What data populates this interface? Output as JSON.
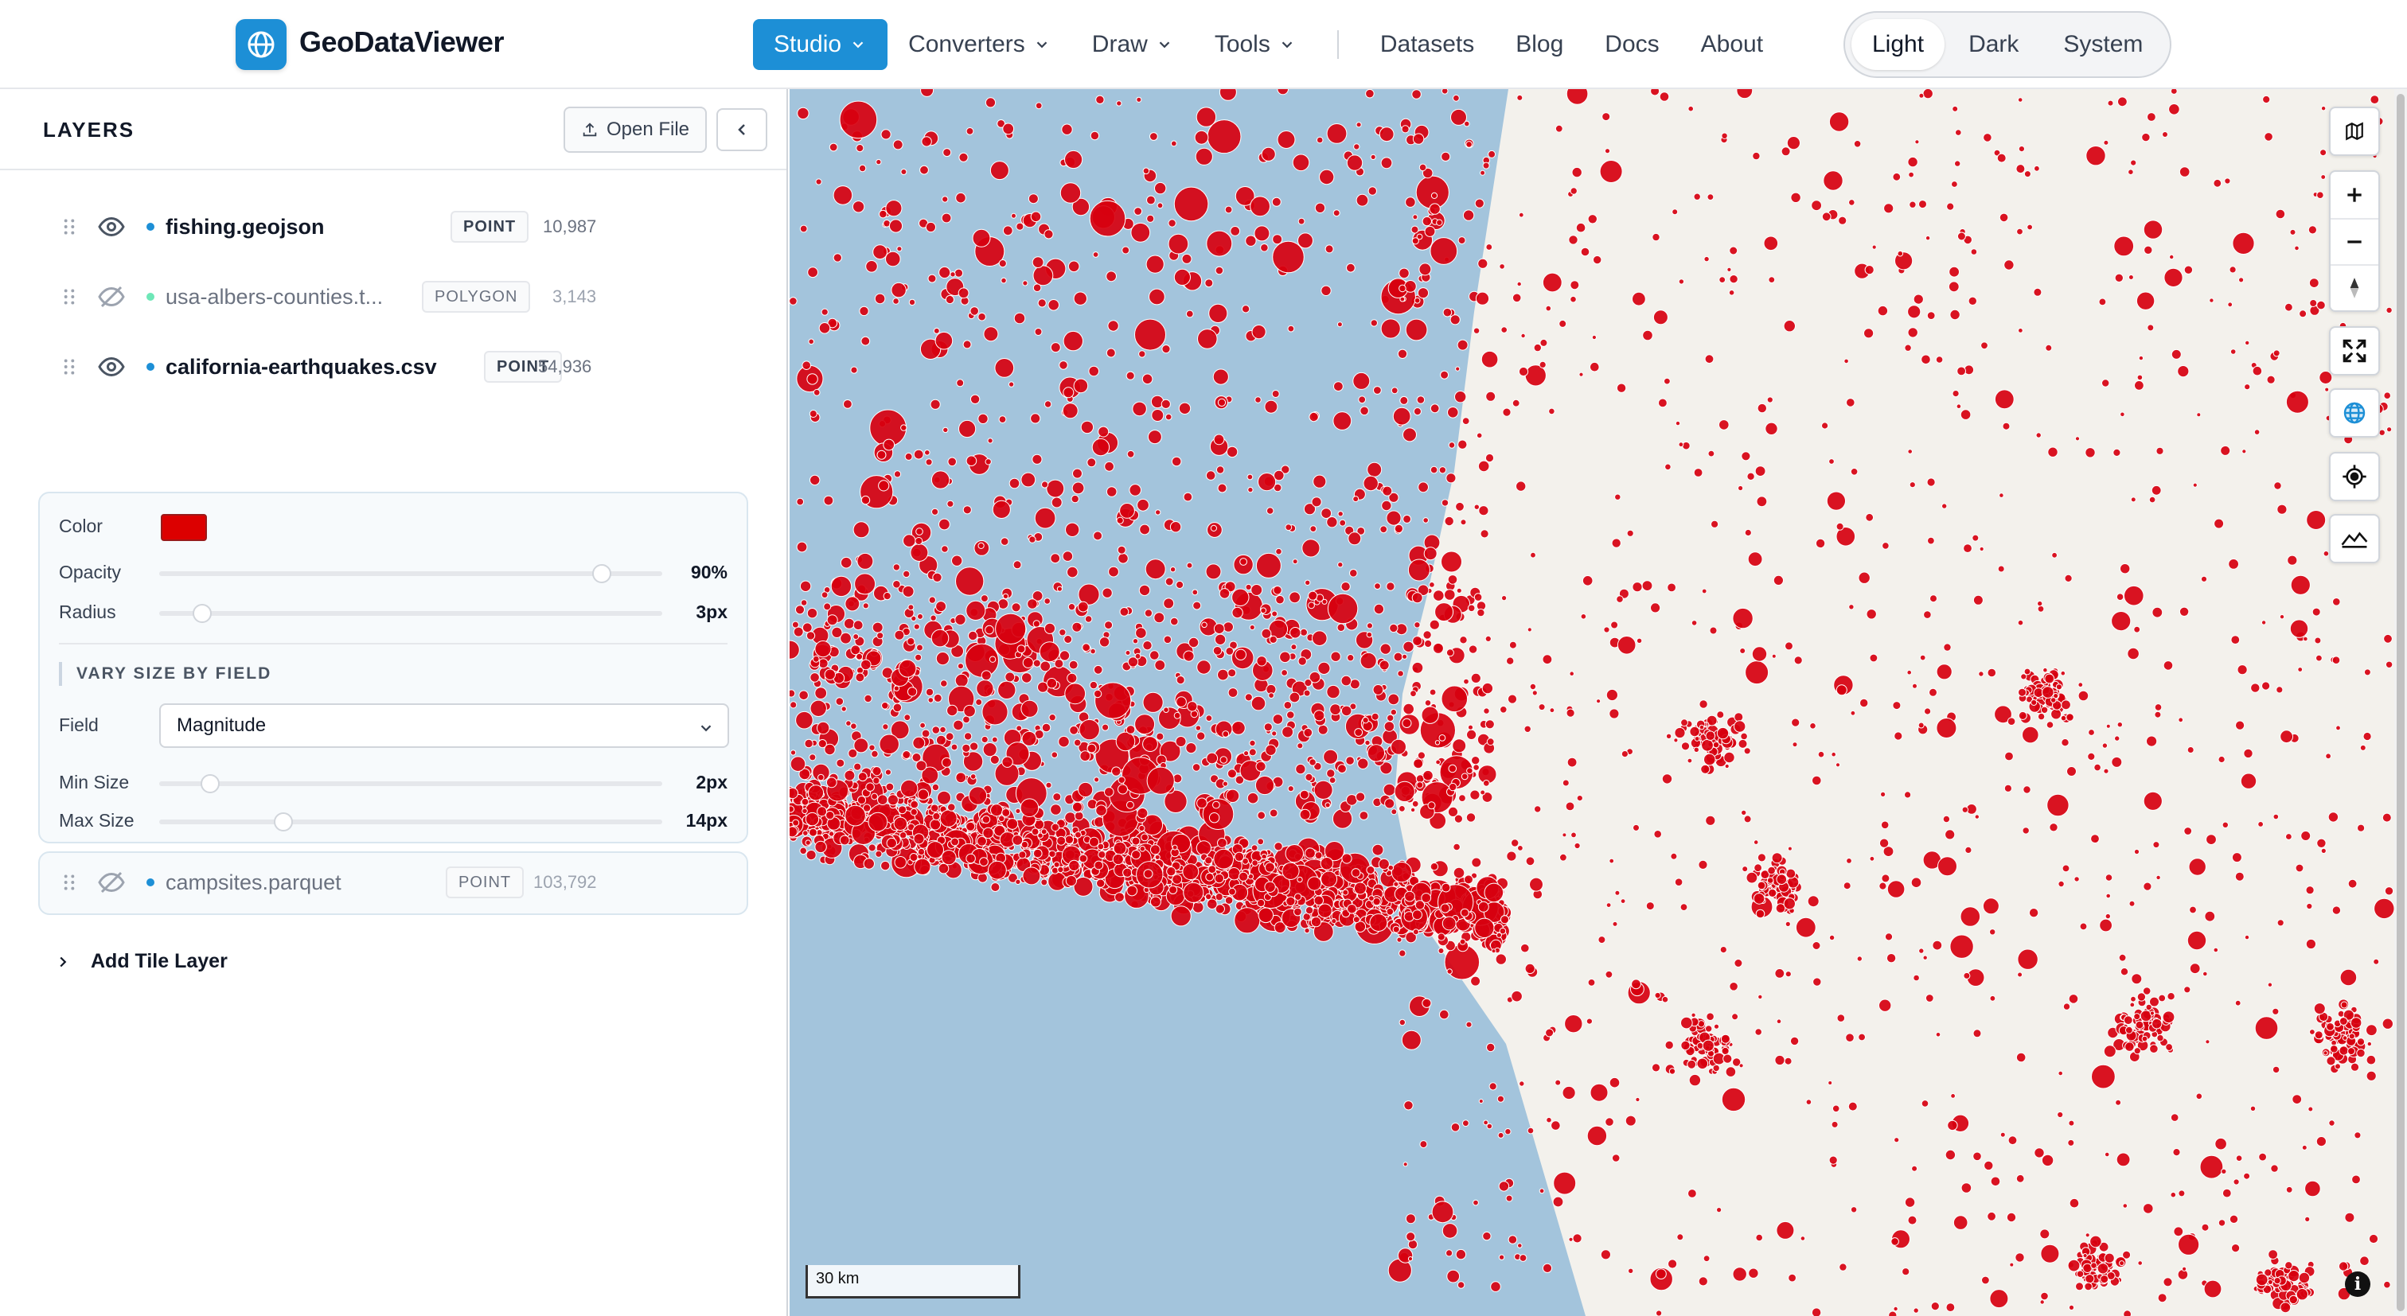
{
  "app": {
    "title": "GeoDataViewer"
  },
  "nav": {
    "items": [
      {
        "label": "Studio",
        "dropdown": true,
        "active": true
      },
      {
        "label": "Converters",
        "dropdown": true
      },
      {
        "label": "Draw",
        "dropdown": true
      },
      {
        "label": "Tools",
        "dropdown": true
      },
      {
        "label": "Datasets"
      },
      {
        "label": "Blog"
      },
      {
        "label": "Docs"
      },
      {
        "label": "About"
      }
    ],
    "theme": {
      "options": [
        "Light",
        "Dark",
        "System"
      ],
      "selected": "Light"
    }
  },
  "sidebar": {
    "title": "LAYERS",
    "open_file_label": "Open File",
    "layers": [
      {
        "name": "fishing.geojson",
        "type": "POINT",
        "count": "10,987",
        "visible": true
      },
      {
        "name": "usa-albers-counties.t...",
        "type": "POLYGON",
        "count": "3,143",
        "visible": false
      },
      {
        "name": "california-earthquakes.csv",
        "type": "POINT",
        "count": "54,936",
        "visible": true
      },
      {
        "name": "campsites.parquet",
        "type": "POINT",
        "count": "103,792",
        "visible": false
      }
    ],
    "settings": {
      "color_label": "Color",
      "color_value": "#dc0000",
      "opacity_label": "Opacity",
      "opacity_value": "90%",
      "opacity_fraction": 0.9,
      "radius_label": "Radius",
      "radius_value": "3px",
      "vary_title": "VARY SIZE BY FIELD",
      "field_label": "Field",
      "field_value": "Magnitude",
      "min_label": "Min Size",
      "min_value": "2px",
      "max_label": "Max Size",
      "max_value": "14px"
    },
    "add_tile_label": "Add Tile Layer"
  },
  "map": {
    "scale_label": "30 km",
    "point_color": "#d7000f",
    "ocean_color": "#a3c4dc",
    "land_color": "#f3f1ec",
    "controls": [
      "map-style-icon",
      "zoom-in-icon",
      "zoom-out-icon",
      "compass-icon",
      "fullscreen-icon",
      "globe-icon",
      "locate-icon",
      "terrain-icon"
    ]
  }
}
